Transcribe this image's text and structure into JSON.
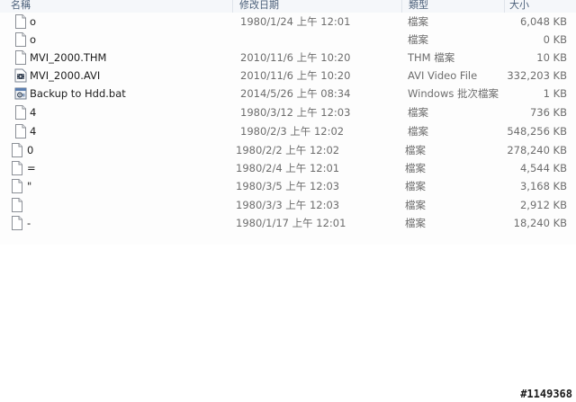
{
  "columns": {
    "name": "名稱",
    "date": "修改日期",
    "type": "類型",
    "size": "大小"
  },
  "files": [
    {
      "name": "o",
      "date": "1980/1/24 上午 12:01",
      "type": "檔案",
      "size": "6,048 KB",
      "icon": "blank-file-icon"
    },
    {
      "name": "o",
      "date": "",
      "type": "檔案",
      "size": "0 KB",
      "icon": "blank-file-icon"
    },
    {
      "name": "MVI_2000.THM",
      "date": "2010/11/6 上午 10:20",
      "type": "THM 檔案",
      "size": "10 KB",
      "icon": "blank-file-icon"
    },
    {
      "name": "MVI_2000.AVI",
      "date": "2010/11/6 上午 10:20",
      "type": "AVI Video File",
      "size": "332,203 KB",
      "icon": "video-file-icon"
    },
    {
      "name": "Backup to Hdd.bat",
      "date": "2014/5/26 上午 08:34",
      "type": "Windows 批次檔案",
      "size": "1 KB",
      "icon": "batch-file-icon"
    },
    {
      "name": "4",
      "date": "1980/3/12 上午 12:03",
      "type": "檔案",
      "size": "736 KB",
      "icon": "blank-file-icon"
    },
    {
      "name": "4",
      "date": "1980/2/3 上午 12:02",
      "type": "檔案",
      "size": "548,256 KB",
      "icon": "blank-file-icon"
    },
    {
      "name": "0",
      "date": "1980/2/2 上午 12:02",
      "type": "檔案",
      "size": "278,240 KB",
      "icon": "blank-file-icon"
    },
    {
      "name": "=",
      "date": "1980/2/4 上午 12:01",
      "type": "檔案",
      "size": "4,544 KB",
      "icon": "blank-file-icon"
    },
    {
      "name": "\"",
      "date": "1980/3/5 上午 12:03",
      "type": "檔案",
      "size": "3,168 KB",
      "icon": "blank-file-icon"
    },
    {
      "name": "",
      "date": "1980/3/3 上午 12:03",
      "type": "檔案",
      "size": "2,912 KB",
      "icon": "blank-file-icon"
    },
    {
      "name": "-",
      "date": "1980/1/17 上午 12:01",
      "type": "檔案",
      "size": "18,240 KB",
      "icon": "blank-file-icon"
    }
  ],
  "watermark": "#1149368"
}
